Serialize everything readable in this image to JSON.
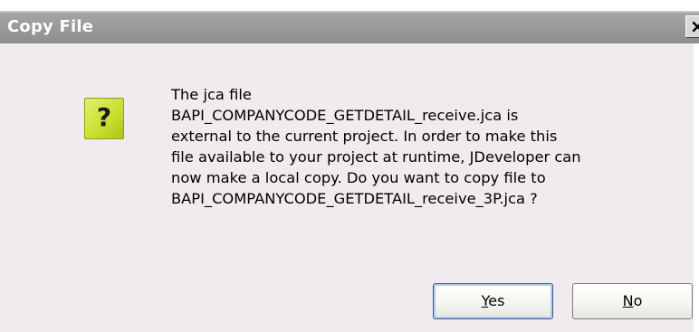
{
  "window": {
    "title": "Copy File",
    "close_glyph": "×"
  },
  "icon": {
    "name": "question-icon",
    "glyph": "?",
    "color": "#c7df2c"
  },
  "message": {
    "lines": [
      "The jca file",
      "BAPI_COMPANYCODE_GETDETAIL_receive.jca is",
      "external to the current project. In order to make this",
      "file available to your project at runtime, JDeveloper can",
      "now make a local copy. Do you want to copy file to",
      "BAPI_COMPANYCODE_GETDETAIL_receive_3P.jca ?"
    ]
  },
  "buttons": {
    "yes": {
      "accel": "Y",
      "rest": "es"
    },
    "no": {
      "accel": "N",
      "rest": "o"
    }
  }
}
